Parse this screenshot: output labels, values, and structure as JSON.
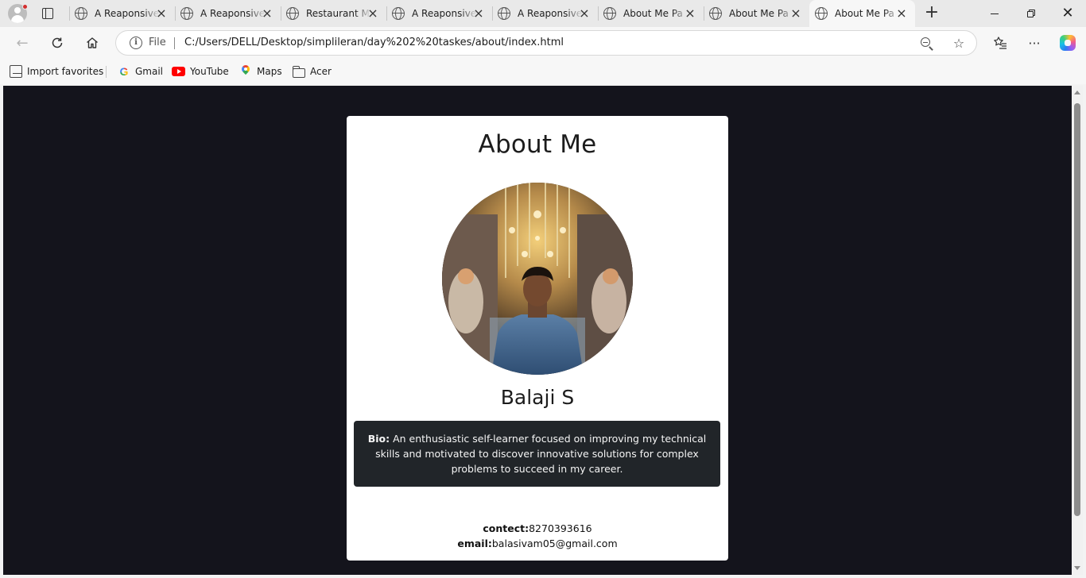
{
  "browser": {
    "tabs": [
      {
        "title": "A Reaponsive",
        "active": false
      },
      {
        "title": "A Reaponsive",
        "active": false
      },
      {
        "title": "Restaurant M",
        "active": false
      },
      {
        "title": "A Reaponsive",
        "active": false
      },
      {
        "title": "A Reaponsive",
        "active": false
      },
      {
        "title": "About Me Pa",
        "active": false
      },
      {
        "title": "About Me Pa",
        "active": false
      },
      {
        "title": "About Me Pa",
        "active": true
      }
    ],
    "address": {
      "scheme_label": "File",
      "url": "C:/Users/DELL/Desktop/simplileran/day%202%20taskes/about/index.html"
    },
    "favorites": [
      {
        "label": "Import favorites",
        "icon": "import-favorites-icon"
      },
      {
        "label": "Gmail",
        "icon": "google-icon"
      },
      {
        "label": "YouTube",
        "icon": "youtube-icon"
      },
      {
        "label": "Maps",
        "icon": "maps-pin-icon"
      },
      {
        "label": "Acer",
        "icon": "folder-icon"
      }
    ]
  },
  "page": {
    "background_color": "#14141c",
    "title": "About Me",
    "name": "Balaji S",
    "bio": {
      "label": "Bio:",
      "text": "An enthusiastic self-learner focused on improving my technical skills and motivated to discover innovative solutions for complex problems to succeed in my career."
    },
    "contact": {
      "phone_label": "contect:",
      "phone": "8270393616",
      "email_label": "email:",
      "email": "balasivam05@gmail.com"
    }
  }
}
